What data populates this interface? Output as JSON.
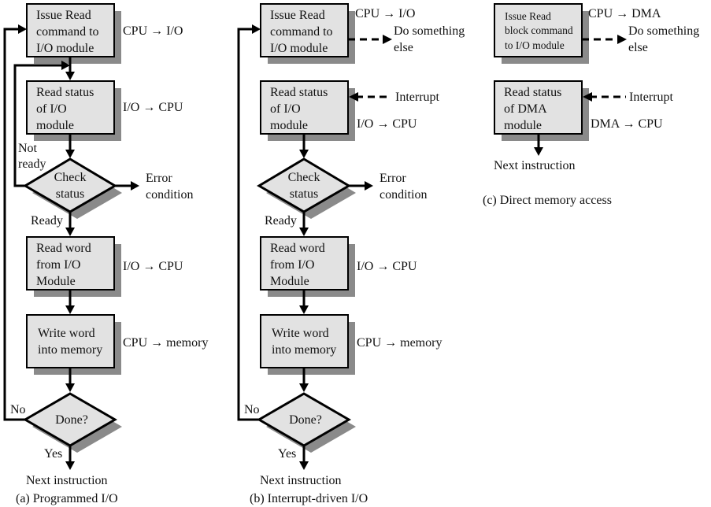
{
  "panels": {
    "a": {
      "caption": "(a) Programmed I/O",
      "issue": [
        "Issue Read",
        "command to",
        "I/O module"
      ],
      "issue_note": "CPU → I/O",
      "status": [
        "Read status",
        "of I/O",
        "module"
      ],
      "status_note": "I/O → CPU",
      "check": [
        "Check",
        "status"
      ],
      "not_ready": [
        "Not",
        "ready"
      ],
      "error": [
        "Error",
        "condition"
      ],
      "ready": "Ready",
      "read_word": [
        "Read word",
        "from I/O",
        "Module"
      ],
      "read_word_note": "I/O → CPU",
      "write_word": [
        "Write word",
        "into memory"
      ],
      "write_word_note": "CPU → memory",
      "done": "Done?",
      "no": "No",
      "yes": "Yes",
      "next": "Next instruction"
    },
    "b": {
      "caption": "(b) Interrupt-driven I/O",
      "issue": [
        "Issue Read",
        "command to",
        "I/O module"
      ],
      "issue_note": "CPU → I/O",
      "do_else": [
        "Do something",
        "else"
      ],
      "status": [
        "Read status",
        "of I/O",
        "module"
      ],
      "interrupt": "Interrupt",
      "status_note": "I/O → CPU",
      "check": [
        "Check",
        "status"
      ],
      "error": [
        "Error",
        "condition"
      ],
      "ready": "Ready",
      "read_word": [
        "Read word",
        "from I/O",
        "Module"
      ],
      "read_word_note": "I/O → CPU",
      "write_word": [
        "Write word",
        "into memory"
      ],
      "write_word_note": "CPU → memory",
      "done": "Done?",
      "no": "No",
      "yes": "Yes",
      "next": "Next instruction"
    },
    "c": {
      "caption": "(c) Direct memory access",
      "issue": [
        "Issue Read",
        "block command",
        "to I/O module"
      ],
      "issue_note": "CPU → DMA",
      "do_else": [
        "Do something",
        "else"
      ],
      "status": [
        "Read status",
        "of DMA",
        "module"
      ],
      "interrupt": "Interrupt",
      "status_note": "DMA → CPU",
      "next": "Next instruction"
    }
  }
}
